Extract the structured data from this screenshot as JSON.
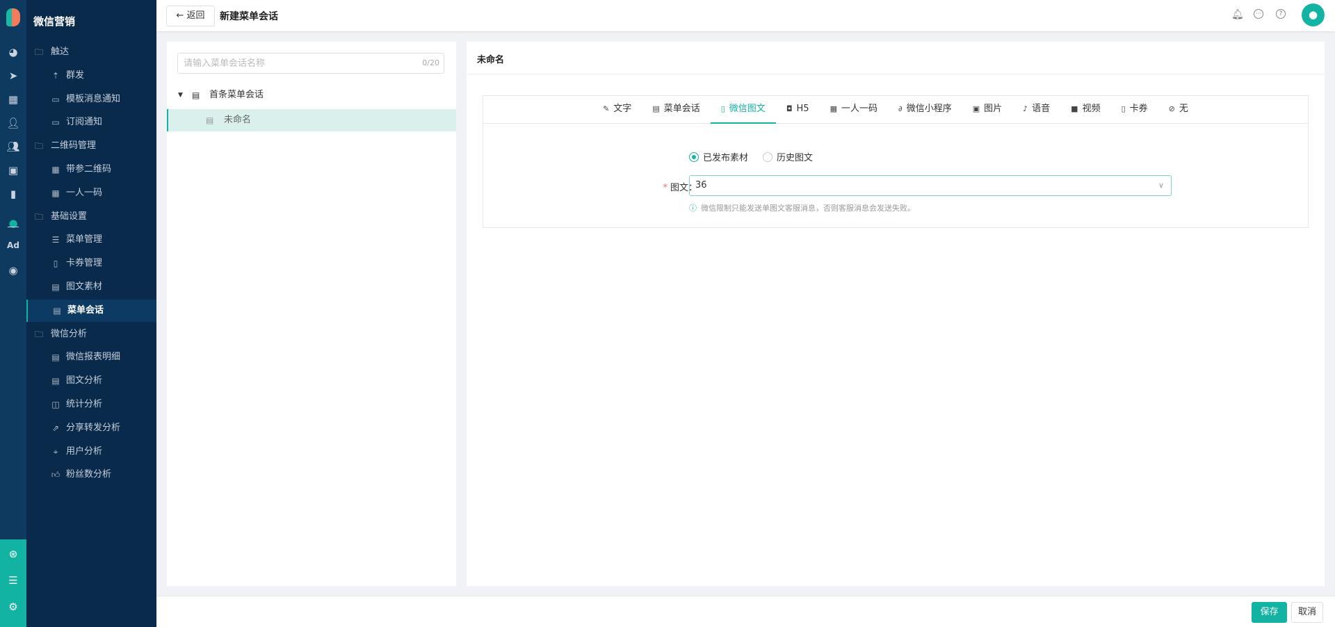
{
  "app": {
    "title": "微信营销",
    "accent": "#13b3a3"
  },
  "strip_icons": [
    "dashboard-icon",
    "send-icon",
    "layout-icon",
    "user-icon",
    "users-icon",
    "bookmark-icon",
    "chart-icon",
    "wechat-icon",
    "ad-icon",
    "play-circle-icon"
  ],
  "strip_ad_label": "Ad",
  "strip_bottom_icons": [
    "network-icon",
    "server-icon",
    "gear-icon"
  ],
  "nav": [
    {
      "type": "folder",
      "label": "触达",
      "icon": "folder-icon"
    },
    {
      "type": "sub",
      "label": "群发",
      "icon": "broadcast-icon"
    },
    {
      "type": "sub",
      "label": "模板消息通知",
      "icon": "message-icon"
    },
    {
      "type": "sub",
      "label": "订阅通知",
      "icon": "message-icon"
    },
    {
      "type": "folder",
      "label": "二维码管理",
      "icon": "folder-icon"
    },
    {
      "type": "sub",
      "label": "带参二维码",
      "icon": "qrcode-icon"
    },
    {
      "type": "sub",
      "label": "一人一码",
      "icon": "qrcode-icon"
    },
    {
      "type": "folder",
      "label": "基础设置",
      "icon": "folder-icon"
    },
    {
      "type": "sub",
      "label": "菜单管理",
      "icon": "list-icon"
    },
    {
      "type": "sub",
      "label": "卡券管理",
      "icon": "coupon-icon"
    },
    {
      "type": "sub",
      "label": "图文素材",
      "icon": "document-icon"
    },
    {
      "type": "sub",
      "label": "菜单会话",
      "icon": "chat-icon",
      "active": true
    },
    {
      "type": "folder",
      "label": "微信分析",
      "icon": "folder-icon"
    },
    {
      "type": "sub",
      "label": "微信报表明细",
      "icon": "document-icon"
    },
    {
      "type": "sub",
      "label": "图文分析",
      "icon": "document-icon"
    },
    {
      "type": "sub",
      "label": "统计分析",
      "icon": "chart-board-icon"
    },
    {
      "type": "sub",
      "label": "分享转发分析",
      "icon": "share-icon"
    },
    {
      "type": "sub",
      "label": "用户分析",
      "icon": "user-scan-icon"
    },
    {
      "type": "sub",
      "label": "粉丝数分析",
      "icon": "thumbs-up-icon"
    }
  ],
  "header": {
    "back_label": "返回",
    "title": "新建菜单会话"
  },
  "left": {
    "search_placeholder": "请输入菜单会话名称",
    "search_value": "",
    "count": "0/20",
    "tree_root": "首条菜单会话",
    "tree_child": "未命名"
  },
  "right": {
    "title": "未命名",
    "tabs": [
      {
        "label": "文字",
        "icon": "pencil-icon",
        "glyph": "✎"
      },
      {
        "label": "菜单会话",
        "icon": "chat-icon",
        "glyph": "▤"
      },
      {
        "label": "微信图文",
        "icon": "document-icon",
        "glyph": "▯",
        "active": true
      },
      {
        "label": "H5",
        "icon": "html5-icon",
        "glyph": "◘"
      },
      {
        "label": "一人一码",
        "icon": "qrcode-icon",
        "glyph": "▦"
      },
      {
        "label": "微信小程序",
        "icon": "link-icon",
        "glyph": "∂"
      },
      {
        "label": "图片",
        "icon": "image-icon",
        "glyph": "▣"
      },
      {
        "label": "语音",
        "icon": "mic-icon",
        "glyph": "♪"
      },
      {
        "label": "视频",
        "icon": "video-icon",
        "glyph": "■"
      },
      {
        "label": "卡券",
        "icon": "coupon-icon",
        "glyph": "▯"
      },
      {
        "label": "无",
        "icon": "ban-icon",
        "glyph": "⊘"
      }
    ],
    "radio_published": "已发布素材",
    "radio_history": "历史图文",
    "field_label": "图文：",
    "field_value": "36",
    "hint": "微信限制只能发送单图文客服消息，否则客服消息会发送失败。"
  },
  "footer": {
    "save": "保存",
    "cancel": "取消"
  }
}
